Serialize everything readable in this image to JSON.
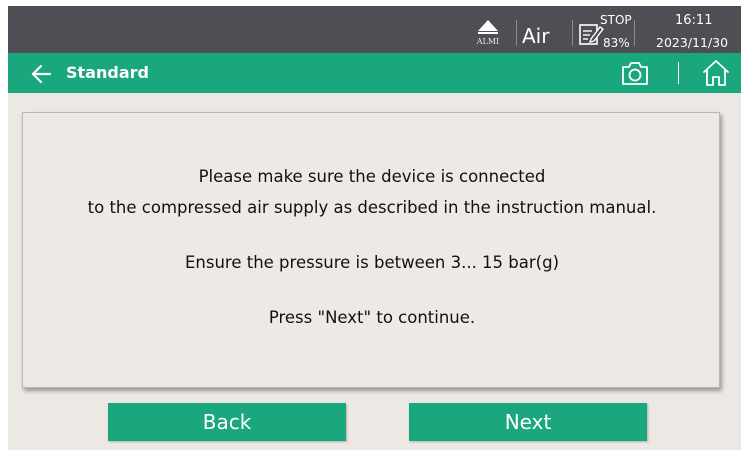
{
  "status_bar": {
    "alarm_label": "ALMI",
    "medium": "Air",
    "state": "STOP",
    "percent": "83%",
    "time": "16:11",
    "date": "2023/11/30"
  },
  "title_bar": {
    "title": "Standard",
    "icons": [
      "back-arrow-icon",
      "camera-icon",
      "home-icon"
    ]
  },
  "message": {
    "line1": "Please make sure the device is connected",
    "line2": "to the compressed air supply as described in the instruction manual.",
    "line3": "Ensure the pressure is between 3... 15 bar(g)",
    "line4": "Press \"Next\" to continue."
  },
  "buttons": {
    "back": "Back",
    "next": "Next"
  },
  "colors": {
    "status_bar_bg": "#4e4f55",
    "accent_green": "#1aa77e",
    "panel_bg": "#ece9e5"
  }
}
